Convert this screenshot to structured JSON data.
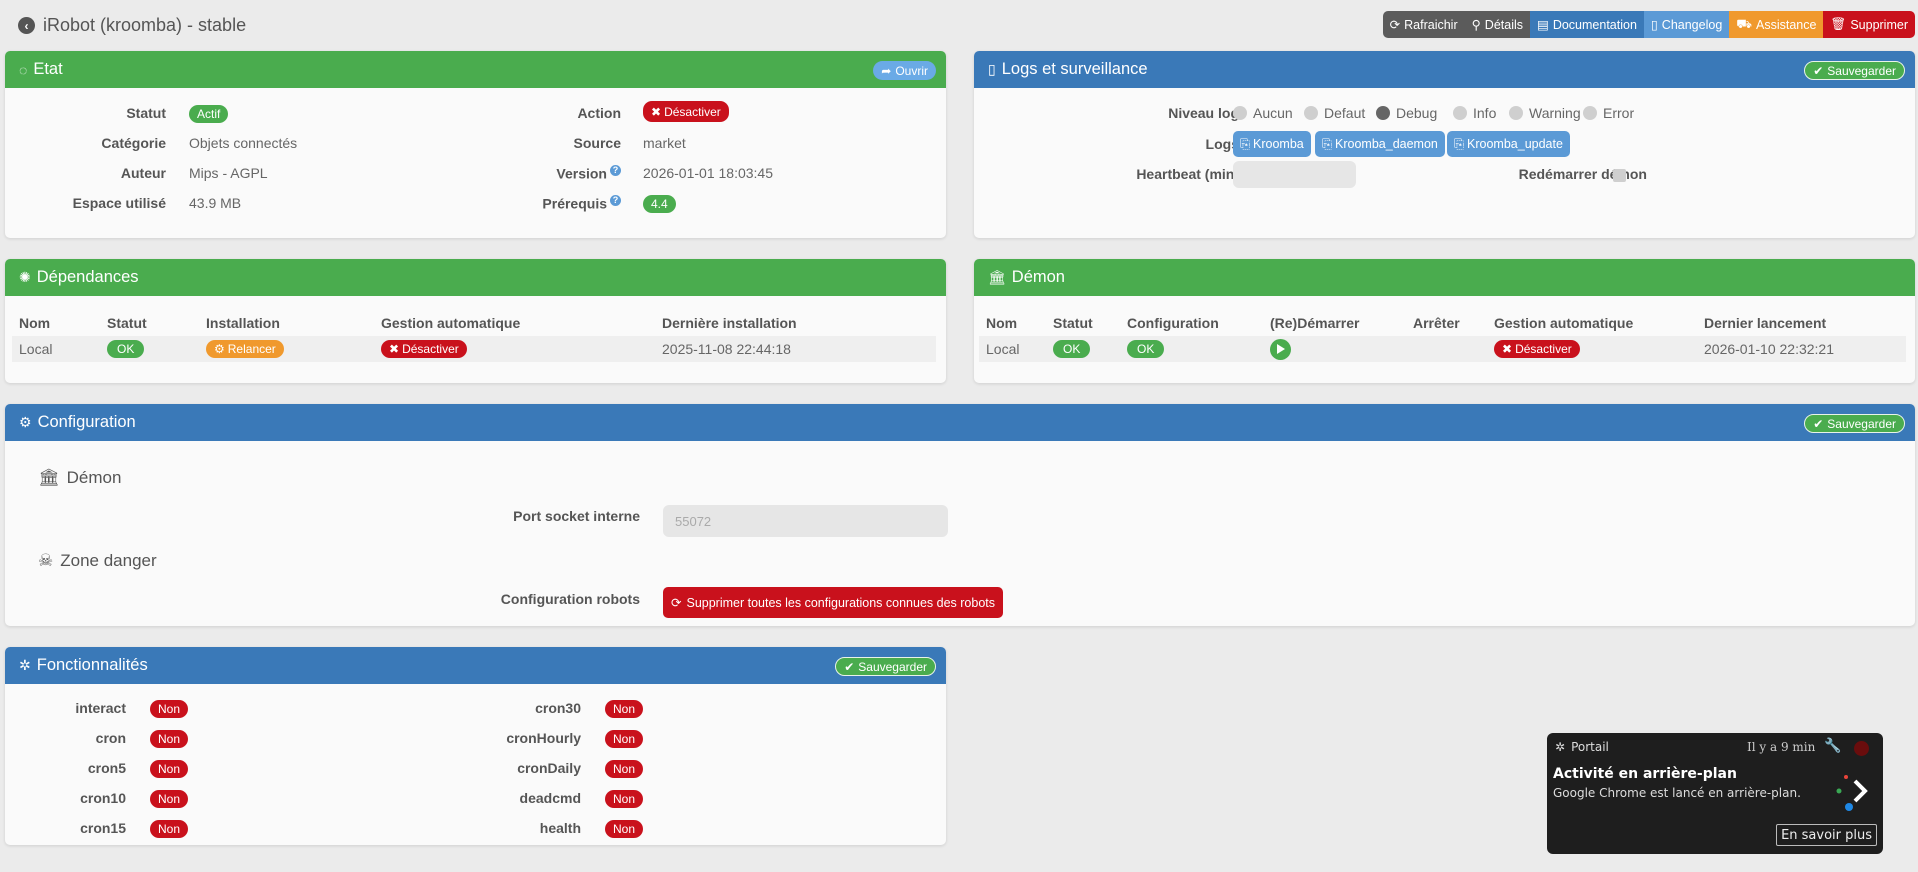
{
  "header": {
    "title": "iRobot (kroomba) - stable",
    "buttons": {
      "refresh": "Rafraichir",
      "details": "Détails",
      "documentation": "Documentation",
      "changelog": "Changelog",
      "assistance": "Assistance",
      "delete": "Supprimer"
    }
  },
  "etat": {
    "title": "Etat",
    "open_btn": "Ouvrir",
    "statut_label": "Statut",
    "statut_value": "Actif",
    "categorie_label": "Catégorie",
    "categorie_value": "Objets connectés",
    "auteur_label": "Auteur",
    "auteur_value": "Mips - AGPL",
    "espace_label": "Espace utilisé",
    "espace_value": "43.9 MB",
    "action_label": "Action",
    "action_value": "Désactiver",
    "source_label": "Source",
    "source_value": "market",
    "version_label": "Version",
    "version_value": "2026-01-01 18:03:45",
    "prerequis_label": "Prérequis",
    "prerequis_value": "4.4"
  },
  "logs": {
    "title": "Logs et surveillance",
    "save_btn": "Sauvegarder",
    "niveau_label": "Niveau log",
    "levels": [
      "Aucun",
      "Defaut",
      "Debug",
      "Info",
      "Warning",
      "Error"
    ],
    "selected_level": "Debug",
    "logs_label": "Logs",
    "log_buttons": [
      "Kroomba",
      "Kroomba_daemon",
      "Kroomba_update"
    ],
    "heartbeat_label": "Heartbeat (min)",
    "restart_label": "Redémarrer démon"
  },
  "dependances": {
    "title": "Dépendances",
    "columns": [
      "Nom",
      "Statut",
      "Installation",
      "Gestion automatique",
      "Dernière installation"
    ],
    "row": {
      "nom": "Local",
      "statut": "OK",
      "installation": "Relancer",
      "gestion": "Désactiver",
      "derniere": "2025-11-08 22:44:18"
    }
  },
  "demon": {
    "title": "Démon",
    "columns": [
      "Nom",
      "Statut",
      "Configuration",
      "(Re)Démarrer",
      "Arrêter",
      "Gestion automatique",
      "Dernier lancement"
    ],
    "row": {
      "nom": "Local",
      "statut": "OK",
      "configuration": "OK",
      "gestion": "Désactiver",
      "dernier": "2026-01-10 22:32:21"
    }
  },
  "configuration": {
    "title": "Configuration",
    "save_btn": "Sauvegarder",
    "demon_section": "Démon",
    "port_label": "Port socket interne",
    "port_placeholder": "55072",
    "danger_section": "Zone danger",
    "robots_label": "Configuration robots",
    "robots_btn": "Supprimer toutes les configurations connues des robots"
  },
  "fonctionnalites": {
    "title": "Fonctionnalités",
    "save_btn": "Sauvegarder",
    "left": [
      {
        "name": "interact",
        "value": "Non"
      },
      {
        "name": "cron",
        "value": "Non"
      },
      {
        "name": "cron5",
        "value": "Non"
      },
      {
        "name": "cron10",
        "value": "Non"
      },
      {
        "name": "cron15",
        "value": "Non"
      }
    ],
    "right": [
      {
        "name": "cron30",
        "value": "Non"
      },
      {
        "name": "cronHourly",
        "value": "Non"
      },
      {
        "name": "cronDaily",
        "value": "Non"
      },
      {
        "name": "deadcmd",
        "value": "Non"
      },
      {
        "name": "health",
        "value": "Non"
      }
    ]
  },
  "notification": {
    "source": "Portail",
    "time": "Il y a 9 min",
    "title": "Activité en arrière-plan",
    "body": "Google Chrome est lancé en arrière-plan.",
    "button": "En savoir plus"
  },
  "colors": {
    "green": "#4aac4e",
    "blue": "#3a79b8",
    "red": "#c9111c",
    "orange": "#f0992d"
  }
}
